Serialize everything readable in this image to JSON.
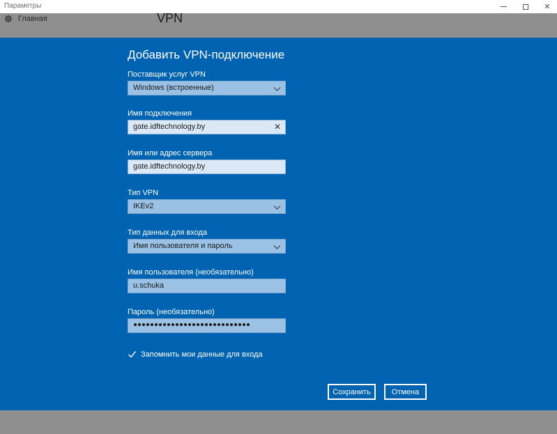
{
  "window": {
    "title": "Параметры",
    "minimize_icon": "minimize-icon",
    "maximize_icon": "maximize-icon",
    "close_icon": "close-icon",
    "close_glyph": "✕"
  },
  "background": {
    "home_label": "Главная",
    "home_icon": "gear-icon",
    "page_title": "VPN"
  },
  "dialog": {
    "title": "Добавить VPN-подключение",
    "provider": {
      "label": "Поставщик услуг VPN",
      "value": "Windows (встроенные)"
    },
    "connection_name": {
      "label": "Имя подключения",
      "value": "gate.idftechnology.by",
      "clear_glyph": "✕"
    },
    "server": {
      "label": "Имя или адрес сервера",
      "value": "gate.idftechnology.by"
    },
    "vpn_type": {
      "label": "Тип VPN",
      "value": "IKEv2"
    },
    "signin_type": {
      "label": "Тип данных для входа",
      "value": "Имя пользователя и пароль"
    },
    "username": {
      "label": "Имя пользователя (необязательно)",
      "value": "u.schuka"
    },
    "password": {
      "label": "Пароль (необязательно)",
      "masked_length": 28
    },
    "remember": {
      "label": "Запомнить мои данные для входа",
      "checked": true
    },
    "save_label": "Сохранить",
    "cancel_label": "Отмена"
  },
  "colors": {
    "dialog_bg": "#0063b1",
    "overlay": "#8f8f8f",
    "field_bg": "#9bc1e5",
    "text_light": "#ffffff"
  }
}
